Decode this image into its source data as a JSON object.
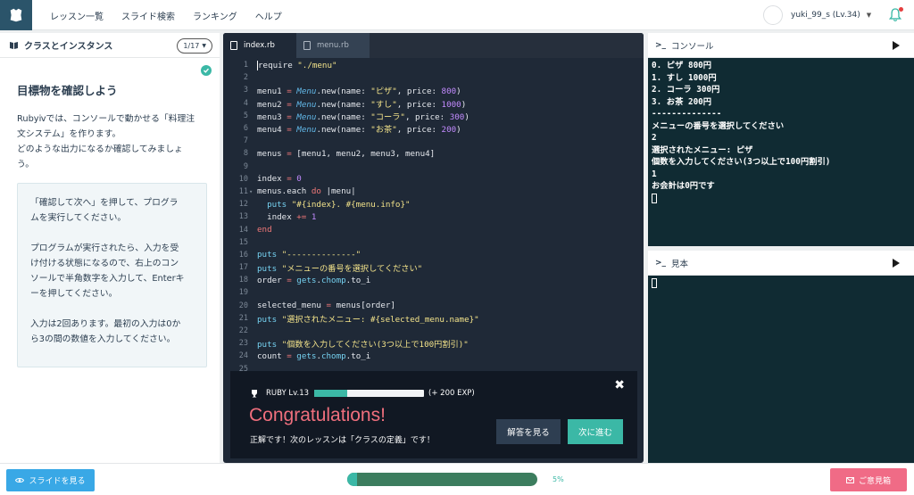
{
  "nav": {
    "links": [
      "レッスン一覧",
      "スライド検索",
      "ランキング",
      "ヘルプ"
    ],
    "username": "yuki_99_s (Lv.34)"
  },
  "lesson": {
    "header_title": "クラスとインスタンス",
    "pager": "1/17",
    "goal_title": "目標物を確認しよう",
    "body_lines": [
      "Rubyⅳでは、コンソールで動かせる「料理注",
      "文システム」を作ります。",
      "どのような出力になるか確認してみましょ",
      "う。"
    ],
    "box_paragraphs": [
      [
        "「確認して次へ」を押して、プログラ",
        "ムを実行してください。"
      ],
      [
        "プログラムが実行されたら、入力を受",
        "け付ける状態になるので、右上のコン",
        "ソールで半角数字を入力して、Enterキ",
        "ーを押してください。"
      ],
      [
        "入力は2回あります。最初の入力は0か",
        "ら3の間の数値を入力してください。"
      ]
    ]
  },
  "editor": {
    "tabs": [
      "index.rb",
      "menu.rb"
    ],
    "line_numbers": [
      "1",
      "2",
      "3",
      "4",
      "5",
      "6",
      "7",
      "8",
      "9",
      "10",
      "11",
      "12",
      "13",
      "14",
      "15",
      "16",
      "17",
      "18",
      "19",
      "20",
      "21",
      "22",
      "23",
      "24",
      "25"
    ]
  },
  "modal": {
    "level": "RUBY Lv.13",
    "xp_fill": 0.3,
    "xp_gain": "(+ 200 EXP)",
    "title": "Congratulations!",
    "message": "正解です！次のレッスンは「クラスの定義」です！",
    "answer_button": "解答を見る",
    "next_button": "次に進む"
  },
  "console": {
    "title": "コンソール",
    "output": [
      "0. ピザ 800円",
      "1. すし 1000円",
      "2. コーラ 300円",
      "3. お茶 200円",
      "--------------",
      "メニューの番号を選択してください",
      "2",
      "選択されたメニュー: ピザ",
      "個数を入力してください(3つ以上で100円割引)",
      "1",
      "お会計は0円です"
    ]
  },
  "sample": {
    "title": "見本"
  },
  "footer": {
    "slide_button": "スライドを見る",
    "progress_fraction": 0.05,
    "progress_label": "5%",
    "feedback_button": "ご意見箱"
  },
  "colors": {
    "accent": "#3bb8a6",
    "brand": "#2b546a",
    "editor_bg": "#1f2937",
    "console_bg": "#102b33",
    "congrats": "#ef6f7d",
    "feedback": "#f06b86",
    "slide_button": "#39a8e6"
  }
}
